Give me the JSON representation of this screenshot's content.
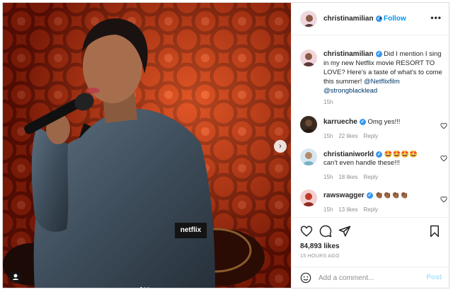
{
  "post": {
    "username": "christinamilian",
    "follow_label": "Follow",
    "more_icon": "more-horizontal-icon",
    "photo_overlay_label": "netflix",
    "carousel": {
      "count": 3,
      "active": 0
    },
    "caption": {
      "username": "christinamilian",
      "text": "Did I mention I sing in my new Netflix movie RESORT TO LOVE? Here's a taste of what's to come this summer!",
      "mention1": "@Netflixfilm",
      "mention2": "@strongblacklead",
      "time": "15h"
    },
    "comments": [
      {
        "username": "karrueche",
        "text": "Omg yes!!!",
        "time": "15h",
        "likes": "22 likes",
        "reply": "Reply"
      },
      {
        "username": "christianiworld",
        "text": "🤩🤩🤩🤩 can't even handle these!!!",
        "time": "15h",
        "likes": "18 likes",
        "reply": "Reply"
      },
      {
        "username": "rawswagger",
        "text": "👏🏾👏🏾👏🏾👏🏾",
        "time": "15h",
        "likes": "13 likes",
        "reply": "Reply"
      }
    ],
    "likes_count": "84,893 likes",
    "posted_ago": "15 HOURS AGO",
    "add_comment_placeholder": "Add a comment...",
    "post_label": "Post"
  },
  "colors": {
    "link": "#0095f6",
    "verified": "#3897f0",
    "muted": "#8e8e8e",
    "text": "#262626",
    "photo_background": "#b52a10"
  },
  "icons": [
    "verified-badge-icon",
    "heart-icon",
    "comment-icon",
    "share-icon",
    "bookmark-icon",
    "emoji-icon",
    "chevron-right-icon",
    "user-tag-icon"
  ]
}
